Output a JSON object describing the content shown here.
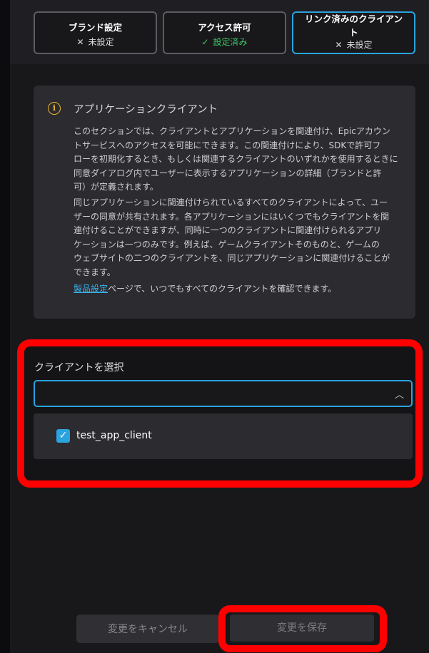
{
  "steps": [
    {
      "title": "ブランド設定",
      "status_mark": "✕",
      "status": "未設定"
    },
    {
      "title": "アクセス許可",
      "status_mark": "✓",
      "status": "設定済み"
    },
    {
      "title_line1": "リンク済みのクライアン",
      "title_line2": "ト",
      "status_mark": "✕",
      "status": "未設定"
    }
  ],
  "info": {
    "icon": "info-icon",
    "icon_glyph": "i",
    "title": "アプリケーションクライアント",
    "para1_lines": [
      "このセクションでは、クライアントとアプリケーションを関連付け、Epicアカウン",
      "トサービスへのアクセスを可能にできます。この関連付けにより、SDKで許可フ",
      "ローを初期化するとき、もしくは関連するクライアントのいずれかを使用するときに",
      "同意ダイアログ内でユーザーに表示するアプリケーションの詳細（ブランドと許",
      "可）が定義されます。"
    ],
    "para2_lines": [
      "同じアプリケーションに関連付けられているすべてのクライアントによって、ユー",
      "ザーの同意が共有されます。各アプリケーションにはいくつでもクライアントを関",
      "連付けることができますが、同時に一つのクライアントに関連付けられるアプリ",
      "ケーションは一つのみです。例えば、ゲームクライアントそのものと、ゲームの",
      "ウェブサイトの二つのクライアントを、同じアプリケーションに関連付けることが",
      "できます。"
    ],
    "link": "製品設定",
    "para3_rest": "ページで、いつでもすべてのクライアントを確認できます。"
  },
  "client_select": {
    "label": "クライアントを選択",
    "value": "",
    "chevron": "chevron-up-icon",
    "chevron_glyph": "︿",
    "options": [
      {
        "label": "test_app_client",
        "checked": true,
        "check_glyph": "✓"
      }
    ]
  },
  "footer": {
    "cancel_label": "変更をキャンセル",
    "save_label": "変更を保存"
  },
  "colors": {
    "accent": "#2aa3df",
    "success": "#3fca65",
    "warning_icon": "#e9b52a",
    "annotation_red": "#ff0000"
  }
}
